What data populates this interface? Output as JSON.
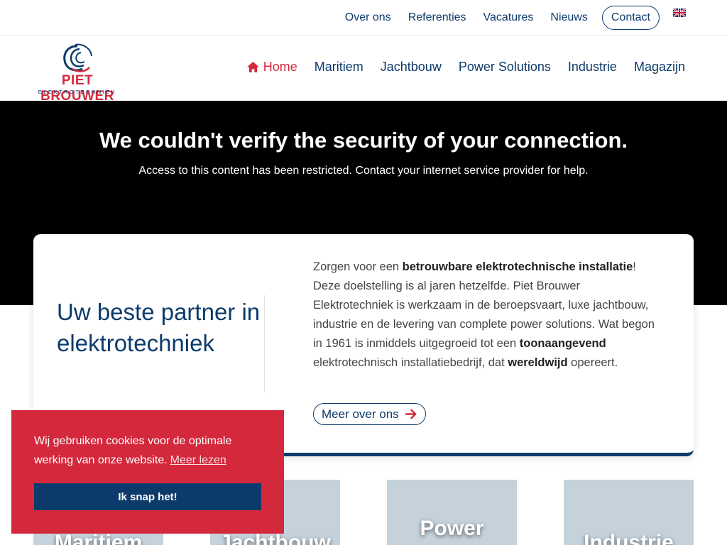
{
  "topnav": {
    "items": [
      "Over ons",
      "Referenties",
      "Vacatures",
      "Nieuws"
    ],
    "contact_label": "Contact"
  },
  "logo": {
    "name": "PIET BROUWER",
    "sub": "ELEKTROTECHNIEK"
  },
  "mainnav": {
    "items": [
      "Home",
      "Maritiem",
      "Jachtbouw",
      "Power Solutions",
      "Industrie",
      "Magazijn"
    ]
  },
  "hero": {
    "title": "We couldn't verify the security of your connection.",
    "subtitle": "Access to this content has been restricted. Contact your internet service provider for help."
  },
  "intro": {
    "heading": "Uw beste partner in elektrotechniek",
    "p1": "Zorgen voor een ",
    "b1": "betrouwbare elektrotechnische installatie",
    "p2": "! Deze doelstelling is al jaren hetzelfde. Piet Brouwer Elektrotechniek is werkzaam in de beroepsvaart, luxe jachtbouw, industrie en de levering van complete power solutions. Wat begon in 1961 is inmiddels uitgegroeid tot een ",
    "b2": "toonaangevend",
    "p3": " elektrotechnisch installatiebedrijf, dat ",
    "b3": "wereldwijd",
    "p4": " opereert.",
    "button": "Meer over ons"
  },
  "tiles": [
    "Maritiem",
    "Jachtbouw",
    "Power",
    "Industrie"
  ],
  "cookie": {
    "text": "Wij gebruiken cookies voor de optimale werking van onze website.",
    "link": "Meer lezen",
    "button": "Ik snap het!"
  },
  "colors": {
    "navy": "#0c3b6b",
    "red": "#d42a3c",
    "tile": "#c5d2dc"
  }
}
